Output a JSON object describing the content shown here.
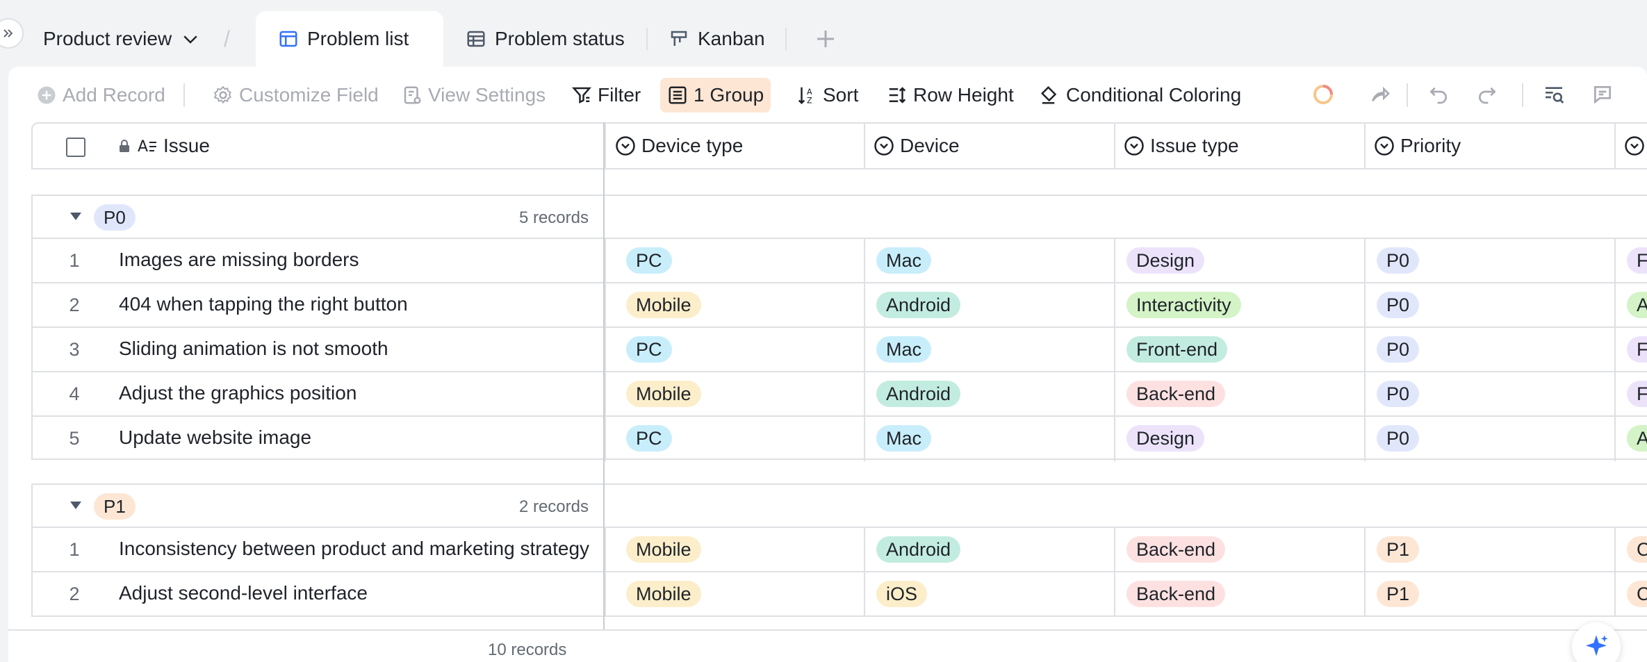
{
  "tabs": {
    "base_name": "Product review",
    "items": [
      {
        "label": "Problem list"
      },
      {
        "label": "Problem status"
      },
      {
        "label": "Kanban"
      }
    ]
  },
  "toolbar": {
    "add_record": "Add Record",
    "customize_field": "Customize Field",
    "view_settings": "View Settings",
    "filter": "Filter",
    "group": "1 Group",
    "sort": "Sort",
    "row_height": "Row Height",
    "conditional_coloring": "Conditional Coloring"
  },
  "columns": [
    "Issue",
    "Device type",
    "Device",
    "Issue type",
    "Priority"
  ],
  "colors": {
    "PC": "#c9eefb",
    "Mobile": "#fceeca",
    "Mac": "#c9eefb",
    "Android": "#c2ecdf",
    "iOS": "#fceeca",
    "Design": "#ece3fb",
    "Interactivity": "#d4f3c6",
    "Front-end": "#c2ecdf",
    "Back-end": "#fde1e1",
    "P0": "#e1e7fb",
    "P1": "#fde6d4"
  },
  "groups": [
    {
      "name": "P0",
      "count_label": "5 records",
      "rows": [
        {
          "num": "1",
          "issue": "Images are missing borders",
          "device_type": "PC",
          "device": "Mac",
          "issue_type": "Design",
          "priority": "P0",
          "extra": "F"
        },
        {
          "num": "2",
          "issue": "404 when tapping the right button",
          "device_type": "Mobile",
          "device": "Android",
          "issue_type": "Interactivity",
          "priority": "P0",
          "extra": "A"
        },
        {
          "num": "3",
          "issue": "Sliding animation is not smooth",
          "device_type": "PC",
          "device": "Mac",
          "issue_type": "Front-end",
          "priority": "P0",
          "extra": "F"
        },
        {
          "num": "4",
          "issue": "Adjust the graphics position",
          "device_type": "Mobile",
          "device": "Android",
          "issue_type": "Back-end",
          "priority": "P0",
          "extra": "F"
        },
        {
          "num": "5",
          "issue": "Update website image",
          "device_type": "PC",
          "device": "Mac",
          "issue_type": "Design",
          "priority": "P0",
          "extra": "A"
        }
      ]
    },
    {
      "name": "P1",
      "count_label": "2 records",
      "rows": [
        {
          "num": "1",
          "issue": "Inconsistency between product and marketing strategy",
          "device_type": "Mobile",
          "device": "Android",
          "issue_type": "Back-end",
          "priority": "P1",
          "extra": "C"
        },
        {
          "num": "2",
          "issue": "Adjust second-level interface",
          "device_type": "Mobile",
          "device": "iOS",
          "issue_type": "Back-end",
          "priority": "P1",
          "extra": "C"
        }
      ]
    }
  ],
  "footer": {
    "total": "10 records"
  }
}
